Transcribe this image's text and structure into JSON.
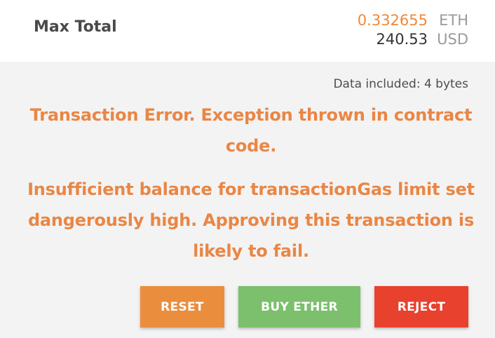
{
  "summary": {
    "max_total_label": "Max Total",
    "eth_amount": "0.332655",
    "eth_unit": "ETH",
    "usd_amount": "240.53",
    "usd_unit": "USD"
  },
  "data_included": "Data included: 4 bytes",
  "errors": {
    "transaction_error": "Transaction Error. Exception thrown in contract code.",
    "insufficient_balance": "Insufficient balance for transactionGas limit set dangerously high. Approving this transaction is likely to fail."
  },
  "buttons": {
    "reset": "RESET",
    "buy_ether": "BUY ETHER",
    "reject": "REJECT"
  },
  "colors": {
    "accent_orange": "#ea8644",
    "buy_green": "#7cbf6c",
    "reject_red": "#e8412e"
  }
}
